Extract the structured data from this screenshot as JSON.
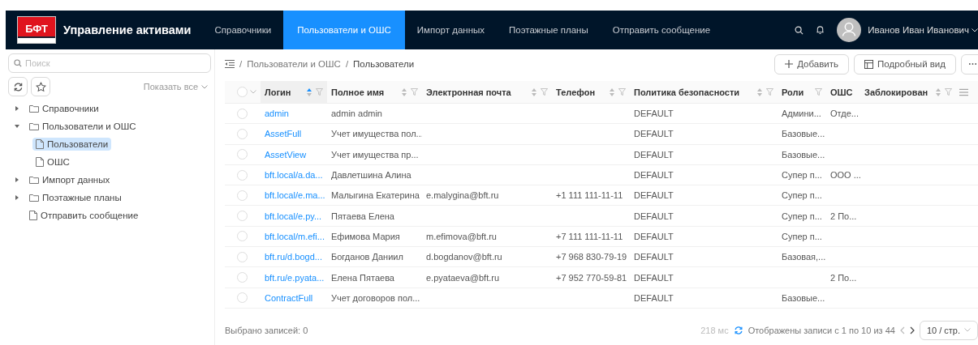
{
  "header": {
    "logo": "БФТ",
    "app_title": "Управление активами",
    "nav": [
      {
        "label": "Справочники",
        "selected": false
      },
      {
        "label": "Пользователи и ОШС",
        "selected": true
      },
      {
        "label": "Импорт данных",
        "selected": false
      },
      {
        "label": "Поэтажные планы",
        "selected": false
      },
      {
        "label": "Отправить сообщение",
        "selected": false
      }
    ],
    "user_name": "Иванов Иван Иванович"
  },
  "sidebar": {
    "search": {
      "placeholder": "Поиск"
    },
    "show_all": "Показать все",
    "tree": [
      {
        "label": "Справочники",
        "kind": "folder",
        "expanded": false,
        "selected": false
      },
      {
        "label": "Пользователи и ОШС",
        "kind": "folder",
        "expanded": true,
        "selected": false,
        "children": [
          {
            "label": "Пользователи",
            "kind": "page",
            "selected": true
          },
          {
            "label": "ОШС",
            "kind": "page",
            "selected": false
          }
        ]
      },
      {
        "label": "Импорт данных",
        "kind": "folder",
        "expanded": false,
        "selected": false
      },
      {
        "label": "Поэтажные планы",
        "kind": "folder",
        "expanded": false,
        "selected": false
      },
      {
        "label": "Отправить сообщение",
        "kind": "page",
        "selected": false
      }
    ]
  },
  "breadcrumb": {
    "separator": "/",
    "items": [
      "Пользователи и ОШС",
      "Пользователи"
    ]
  },
  "toolbar": {
    "add": "Добавить",
    "detail_view": "Подробный вид"
  },
  "table": {
    "all_selected": false,
    "columns": [
      {
        "label": "Логин",
        "sortable": true,
        "sorted": true,
        "filterable": true
      },
      {
        "label": "Полное имя",
        "sortable": true,
        "sorted": false,
        "filterable": true
      },
      {
        "label": "Электронная почта",
        "sortable": true,
        "sorted": false,
        "filterable": true
      },
      {
        "label": "Телефон",
        "sortable": true,
        "sorted": false,
        "filterable": true
      },
      {
        "label": "Политика безопасности",
        "sortable": true,
        "sorted": false,
        "filterable": true
      },
      {
        "label": "Роли",
        "sortable": false,
        "sorted": false,
        "filterable": true
      },
      {
        "label": "ОШС",
        "sortable": false,
        "sorted": false,
        "filterable": false
      },
      {
        "label": "Заблокирован",
        "sortable": true,
        "sorted": false,
        "filterable": true
      }
    ],
    "rows": [
      {
        "selected": false,
        "cells": [
          "admin",
          "admin admin",
          null,
          null,
          "DEFAULT",
          "Админи...",
          "Отде...",
          null
        ]
      },
      {
        "selected": false,
        "cells": [
          "AssetFull",
          "Учет имущества пол...",
          null,
          null,
          "DEFAULT",
          "Базовые...",
          null,
          null
        ]
      },
      {
        "selected": false,
        "cells": [
          "AssetView",
          "Учет имущества пр...",
          null,
          null,
          "DEFAULT",
          "Базовые...",
          null,
          null
        ]
      },
      {
        "selected": false,
        "cells": [
          "bft.local/a.da...",
          "Давлетшина Алина",
          null,
          null,
          "DEFAULT",
          "Супер п...",
          "ООО ...",
          null
        ]
      },
      {
        "selected": false,
        "cells": [
          "bft.local/e.ma...",
          "Малыгина Екатерина",
          "e.malygina@bft.ru",
          "+1 111 111-11-11",
          "DEFAULT",
          "Супер п...",
          null,
          null
        ]
      },
      {
        "selected": false,
        "cells": [
          "bft.local/e.py...",
          "Пятаева Елена",
          null,
          null,
          "DEFAULT",
          "Супер п...",
          "2 По...",
          null
        ]
      },
      {
        "selected": false,
        "cells": [
          "bft.local/m.efi...",
          "Ефимова Мария",
          "m.efimova@bft.ru",
          "+7 111 111-11-11",
          "DEFAULT",
          "Супер п...",
          null,
          null
        ]
      },
      {
        "selected": false,
        "cells": [
          "bft.ru/d.bogd...",
          "Богданов Даниил",
          "d.bogdanov@bft.ru",
          "+7 968 830-79-19",
          "DEFAULT",
          "Базовая,...",
          null,
          null
        ]
      },
      {
        "selected": false,
        "cells": [
          "bft.ru/e.pyata...",
          "Елена Пятаева",
          "e.pyataeva@bft.ru",
          "+7 952 770-59-81",
          "DEFAULT",
          null,
          "2 По...",
          null
        ]
      },
      {
        "selected": false,
        "cells": [
          "ContractFull",
          "Учет договоров пол...",
          null,
          null,
          "DEFAULT",
          "Базовые...",
          null,
          null
        ]
      }
    ]
  },
  "footer": {
    "selected_count": "Выбрано записей: 0",
    "timing": "218 мс",
    "records": "Отображены записи с 1 по 10 из 44",
    "page_size": "10 / стр."
  }
}
